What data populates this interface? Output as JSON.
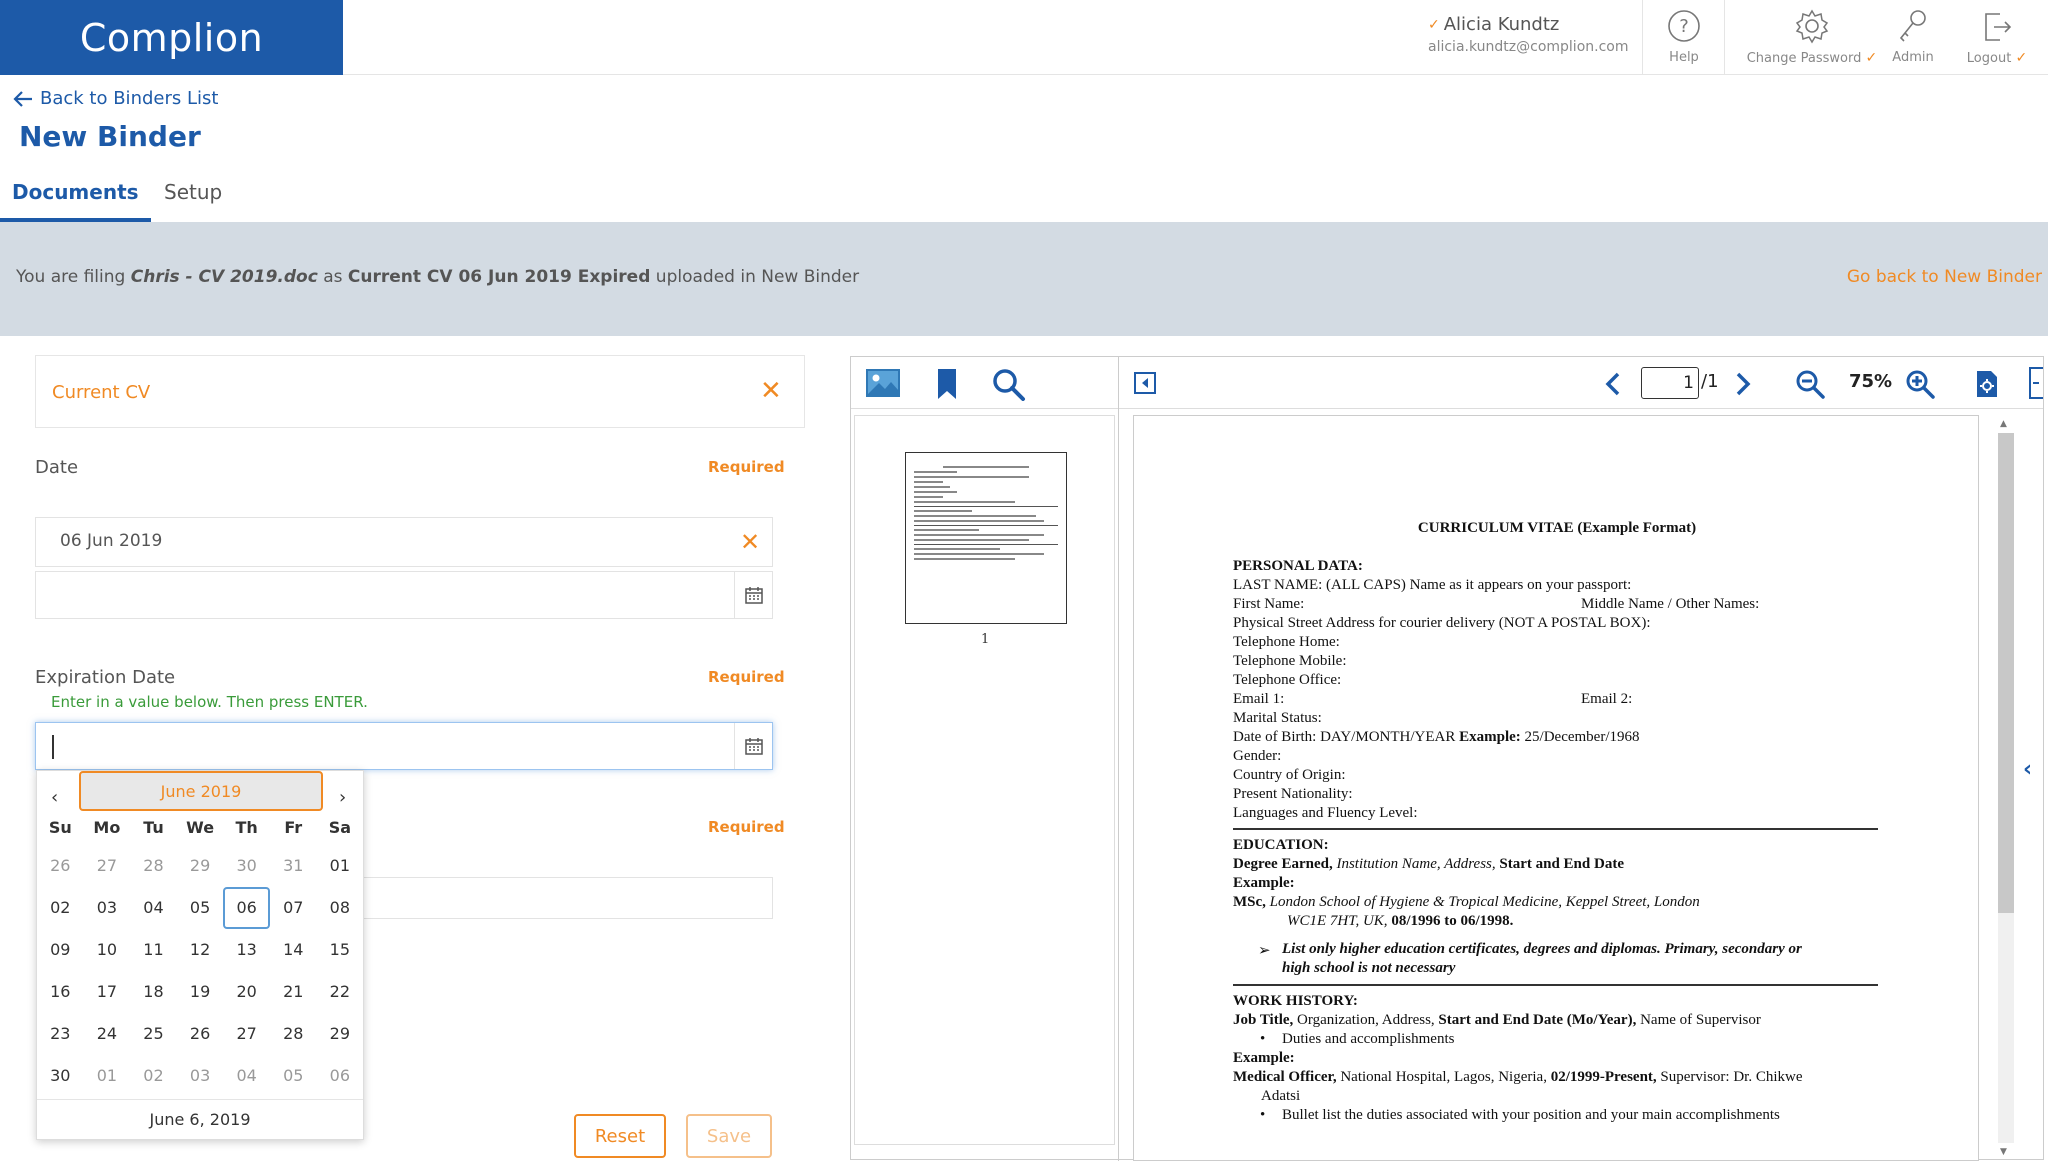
{
  "header": {
    "logo": "Complion",
    "user_name": "Alicia Kundtz",
    "user_email": "alicia.kundtz@complion.com",
    "help_label": "Help",
    "change_password_label": "Change Password",
    "admin_label": "Admin",
    "logout_label": "Logout"
  },
  "nav": {
    "back_label": "Back to Binders List",
    "page_title": "New Binder",
    "tabs": [
      {
        "label": "Documents",
        "active": true
      },
      {
        "label": "Setup",
        "active": false
      }
    ]
  },
  "banner": {
    "prefix": "You are filing",
    "file_name": "Chris - CV 2019.doc",
    "as": "as",
    "doc_label": "Current CV 06 Jun 2019 Expired",
    "suffix": "uploaded in New Binder",
    "go_back": "Go back to New Binder"
  },
  "form": {
    "doc_type": "Current CV",
    "date_label": "Date",
    "date_required": "Required",
    "date_value": "06 Jun 2019",
    "expiration_label": "Expiration Date",
    "expiration_required": "Required",
    "expiration_hint": "Enter in a value below. Then press ENTER.",
    "third_required": "Required",
    "reset_label": "Reset",
    "save_label": "Save"
  },
  "datepicker": {
    "month_label": "June 2019",
    "prev": "‹",
    "next": "›",
    "weekdays": [
      "Su",
      "Mo",
      "Tu",
      "We",
      "Th",
      "Fr",
      "Sa"
    ],
    "weeks": [
      [
        "26",
        "27",
        "28",
        "29",
        "30",
        "31",
        "01"
      ],
      [
        "02",
        "03",
        "04",
        "05",
        "06",
        "07",
        "08"
      ],
      [
        "09",
        "10",
        "11",
        "12",
        "13",
        "14",
        "15"
      ],
      [
        "16",
        "17",
        "18",
        "19",
        "20",
        "21",
        "22"
      ],
      [
        "23",
        "24",
        "25",
        "26",
        "27",
        "28",
        "29"
      ],
      [
        "30",
        "01",
        "02",
        "03",
        "04",
        "05",
        "06"
      ]
    ],
    "selected_day": "06",
    "today_label": "June 6, 2019"
  },
  "viewer": {
    "page_current": "1",
    "page_total": "/1",
    "zoom": "75%",
    "thumb_page_number": "1",
    "document": {
      "title": "CURRICULUM VITAE  (Example Format)",
      "personal_heading": "PERSONAL DATA:",
      "last_name": "LAST NAME: (ALL CAPS) Name as it appears on your passport:",
      "first_name": "First Name:",
      "middle_name": "Middle Name / Other Names:",
      "address": "Physical Street Address for courier delivery (NOT A POSTAL BOX):",
      "tel_home": "Telephone Home:",
      "tel_mobile": "Telephone Mobile:",
      "tel_office": "Telephone Office:",
      "email1": "Email 1:",
      "email2": "Email 2:",
      "marital": "Marital Status:",
      "dob_prefix": "Date of Birth:  DAY/MONTH/YEAR",
      "dob_example_label": "Example:",
      "dob_example": "25/December/1968",
      "gender": "Gender:",
      "country": "Country of Origin:",
      "nationality": "Present Nationality:",
      "languages": "Languages and Fluency Level:",
      "education_heading": "EDUCATION:",
      "degree_label": "Degree Earned,",
      "degree_italic": "Institution Name, Address,",
      "degree_bold": "Start and End Date",
      "example_label": "Example:",
      "msc_label": "MSc,",
      "msc_italic": "London School of Hygiene & Tropical Medicine, Keppel Street, London",
      "msc_line2_italic": "WC1E 7HT, UK,",
      "msc_line2_bold": "08/1996 to 06/1998.",
      "edu_note_line1": "List only higher education certificates, degrees and diplomas.  Primary, secondary or",
      "edu_note_line2": "high school is not necessary",
      "work_heading": "WORK HISTORY:",
      "job_title_bold": "Job Title,",
      "job_org": "Organization, Address,",
      "job_dates_bold": "Start and End Date (Mo/Year),",
      "job_supervisor": "Name of Supervisor",
      "duties": "Duties and accomplishments",
      "work_example_label": "Example:",
      "medical_bold": "Medical Officer,",
      "medical_text": "National Hospital, Lagos, Nigeria,",
      "medical_dates_bold": "02/1999-Present,",
      "medical_supervisor": "Supervisor:  Dr. Chikwe",
      "medical_line2": "Adatsi",
      "bullet_duties": "Bullet list the duties associated with your position and your main accomplishments"
    }
  },
  "colors": {
    "brand": "#1d5aa8",
    "accent": "#f08a24",
    "banner_bg": "#d3dbe3",
    "hint": "#3a9b3a"
  }
}
